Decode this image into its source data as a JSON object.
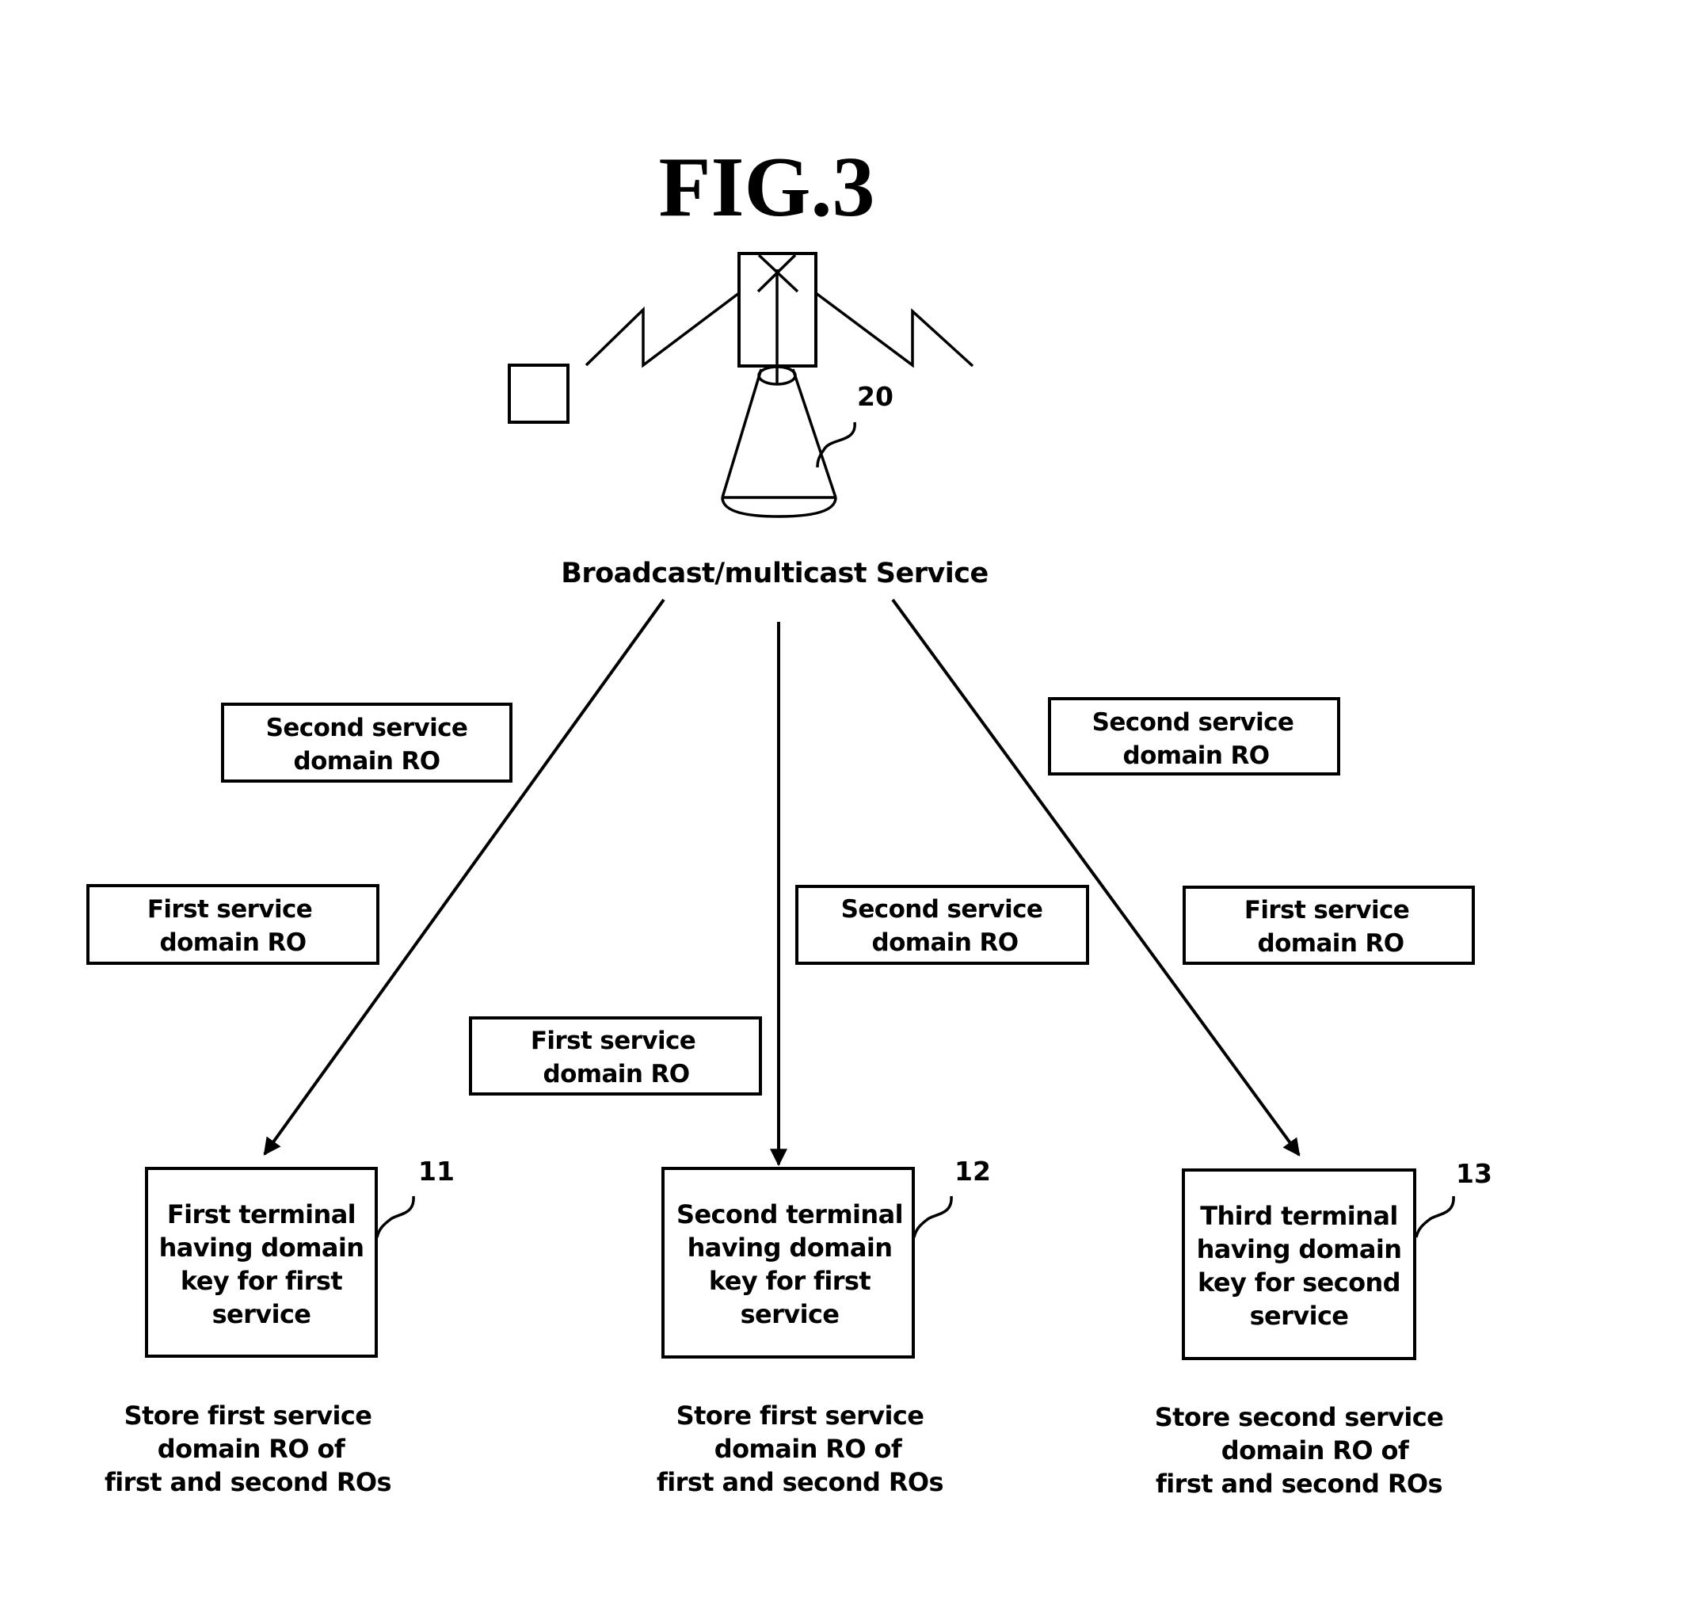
{
  "figure": {
    "title": "FIG.3"
  },
  "source": {
    "ref_number": "20",
    "label": "Broadcast/multicast Service",
    "icons": [
      "broadcast-tower-icon",
      "receiver-square-icon",
      "lightning-signal-icon",
      "cone-base-icon"
    ]
  },
  "ro_boxes": [
    {
      "id": "left-second",
      "lines": [
        "Second service",
        "domain RO"
      ]
    },
    {
      "id": "left-first",
      "lines": [
        "First service",
        "domain RO"
      ]
    },
    {
      "id": "middle-second",
      "lines": [
        "Second service",
        "domain RO"
      ]
    },
    {
      "id": "middle-first",
      "lines": [
        "First service",
        "domain RO"
      ]
    },
    {
      "id": "right-second",
      "lines": [
        "Second service",
        "domain RO"
      ]
    },
    {
      "id": "right-first",
      "lines": [
        "First service",
        "domain RO"
      ]
    }
  ],
  "terminals": [
    {
      "ref_number": "11",
      "lines": [
        "First terminal",
        "having domain",
        "key for first",
        "service"
      ],
      "caption": [
        "Store first service",
        "domain RO of",
        "first and second ROs"
      ]
    },
    {
      "ref_number": "12",
      "lines": [
        "Second terminal",
        "having domain",
        "key for first",
        "service"
      ],
      "caption": [
        "Store first service",
        "domain RO of",
        "first and second ROs"
      ]
    },
    {
      "ref_number": "13",
      "lines": [
        "Third terminal",
        "having domain",
        "key for second",
        "service"
      ],
      "caption": [
        "Store second service",
        "domain RO of",
        "first and second ROs"
      ]
    }
  ],
  "arrows": [
    {
      "from": "source",
      "to": "terminal-11"
    },
    {
      "from": "source",
      "to": "terminal-12"
    },
    {
      "from": "source",
      "to": "terminal-13"
    }
  ]
}
